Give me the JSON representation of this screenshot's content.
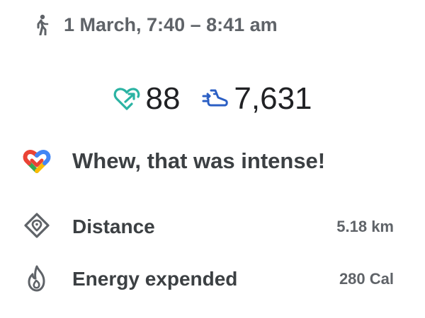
{
  "header": {
    "activity_icon": "walking-person-icon",
    "datetime": "1 March, 7:40 – 8:41 am"
  },
  "metrics": {
    "heart_points": {
      "icon": "heart-points-icon",
      "value": "88",
      "color": "#2bb3a3"
    },
    "steps": {
      "icon": "steps-shoe-icon",
      "value": "7,631",
      "color": "#2b5fc4"
    }
  },
  "message": {
    "icon": "google-fit-logo",
    "text": "Whew, that was intense!"
  },
  "stats": [
    {
      "icon": "location-diamond-icon",
      "label": "Distance",
      "value": "5.18 km"
    },
    {
      "icon": "flame-icon",
      "label": "Energy expended",
      "value": "280 Cal"
    }
  ],
  "colors": {
    "text_primary": "#3c4043",
    "text_secondary": "#5f6368",
    "fit_red": "#ea4335",
    "fit_yellow": "#fbbc04",
    "fit_green": "#34a853",
    "fit_blue": "#4285f4"
  }
}
